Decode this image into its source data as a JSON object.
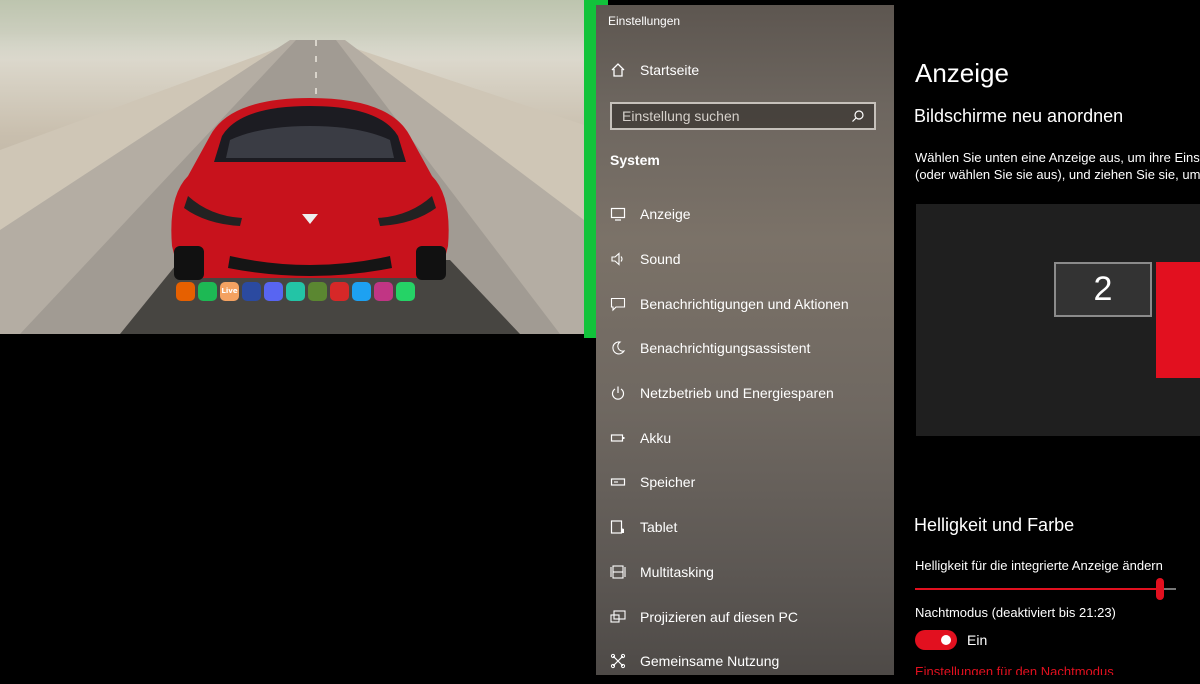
{
  "colors": {
    "accent": "#e2101f",
    "green_bar": "#12c33b"
  },
  "dock": {
    "icons": [
      {
        "name": "firefox-icon",
        "glyph": "",
        "color": "#e66000"
      },
      {
        "name": "spotify-icon",
        "glyph": "",
        "color": "#1db954"
      },
      {
        "name": "live-icon",
        "glyph": "Live",
        "color": "#f4a261"
      },
      {
        "name": "davinci-resolve-icon",
        "glyph": "",
        "color": "#2b4aa0"
      },
      {
        "name": "discord-icon",
        "glyph": "",
        "color": "#5865f2"
      },
      {
        "name": "chat-app-icon",
        "glyph": "",
        "color": "#23c4a6"
      },
      {
        "name": "minecraft-icon",
        "glyph": "",
        "color": "#5b8731"
      },
      {
        "name": "pokerstars-icon",
        "glyph": "",
        "color": "#d62828"
      },
      {
        "name": "twitter-icon",
        "glyph": "",
        "color": "#1da1f2"
      },
      {
        "name": "instagram-icon",
        "glyph": "",
        "color": "#c13584"
      },
      {
        "name": "whatsapp-icon",
        "glyph": "",
        "color": "#25d366"
      }
    ]
  },
  "sidebar": {
    "window_title": "Einstellungen",
    "home_label": "Startseite",
    "search_placeholder": "Einstellung suchen",
    "section_label": "System",
    "items": [
      {
        "label": "Anzeige",
        "icon": "monitor-icon"
      },
      {
        "label": "Sound",
        "icon": "speaker-icon"
      },
      {
        "label": "Benachrichtigungen und Aktionen",
        "icon": "notification-icon"
      },
      {
        "label": "Benachrichtigungsassistent",
        "icon": "moon-icon"
      },
      {
        "label": "Netzbetrieb und Energiesparen",
        "icon": "power-icon"
      },
      {
        "label": "Akku",
        "icon": "battery-icon"
      },
      {
        "label": "Speicher",
        "icon": "storage-icon"
      },
      {
        "label": "Tablet",
        "icon": "tablet-icon"
      },
      {
        "label": "Multitasking",
        "icon": "multitasking-icon"
      },
      {
        "label": "Projizieren auf diesen PC",
        "icon": "project-icon"
      },
      {
        "label": "Gemeinsame Nutzung",
        "icon": "share-icon"
      }
    ]
  },
  "main": {
    "title": "Anzeige",
    "rearrange_heading": "Bildschirme neu anordnen",
    "rearrange_desc_line1": "Wählen Sie unten eine Anzeige aus, um ihre Einste",
    "rearrange_desc_line2": "(oder wählen Sie sie aus), und ziehen Sie sie, um s",
    "monitor_2_label": "2",
    "brightness_heading": "Helligkeit und Farbe",
    "brightness_label": "Helligkeit für die integrierte Anzeige ändern",
    "brightness_level": 0.94,
    "night_mode_label": "Nachtmodus (deaktiviert bis 21:23)",
    "night_mode_toggle_label": "Ein",
    "night_mode_settings_link": "Einstellungen für den Nachtmodus"
  }
}
